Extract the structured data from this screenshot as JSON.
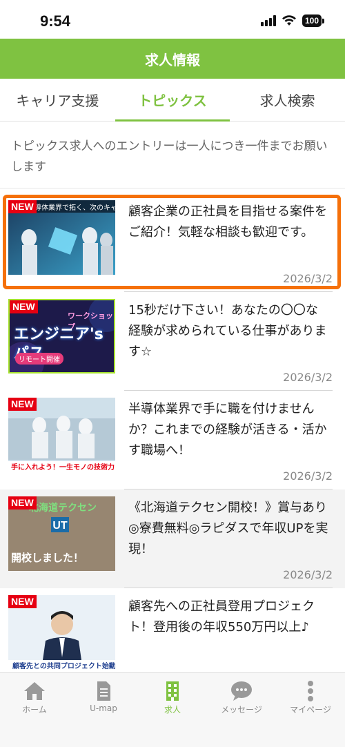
{
  "status_bar": {
    "time": "9:54",
    "battery": "100"
  },
  "header": {
    "title": "求人情報"
  },
  "tabs": [
    {
      "label": "キャリア支援"
    },
    {
      "label": "トピックス"
    },
    {
      "label": "求人検索"
    }
  ],
  "notice": "トピックス求人へのエントリーは一人につき一件までお願いします",
  "items": [
    {
      "badge": "NEW",
      "thumb_caption": "導体業界で拓く、次のキャリア",
      "title": "顧客企業の正社員を目指せる案件をご紹介！気軽な相談も歓迎です。",
      "date": "2026/3/2"
    },
    {
      "badge": "NEW",
      "thumb_caption": "ワークショップ",
      "thumb_main": "エンジニア'sパス",
      "thumb_tag": "リモート開催",
      "title": "15秒だけ下さい！あなたの〇〇な経験が求められている仕事があります☆",
      "date": "2026/3/2"
    },
    {
      "badge": "NEW",
      "thumb_caption": "手に入れよう！一生モノの技術力！",
      "title": "半導体業界で手に職を付けませんか？これまでの経験が活きる・活かす職場へ！",
      "date": "2026/3/2"
    },
    {
      "badge": "NEW",
      "thumb_caption": "北海道テクセン",
      "thumb_main": "開校しました！",
      "title": "《北海道テクセン開校！》賞与あり◎寮費無料◎ラピダスで年収UPを実現！",
      "date": "2026/3/2"
    },
    {
      "badge": "NEW",
      "thumb_caption": "顧客先との共同プロジェクト始動！",
      "title": "顧客先への正社員登用プロジェクト！登用後の年収550万円以上♪",
      "date": ""
    }
  ],
  "bottom_nav": [
    {
      "label": "ホーム",
      "icon": "home-icon"
    },
    {
      "label": "U-map",
      "icon": "document-icon"
    },
    {
      "label": "求人",
      "icon": "building-icon"
    },
    {
      "label": "メッセージ",
      "icon": "chat-icon"
    },
    {
      "label": "マイページ",
      "icon": "more-vertical-icon"
    }
  ],
  "colors": {
    "brand": "#7fc241",
    "highlight": "#f5700a",
    "badge": "#e60012"
  }
}
